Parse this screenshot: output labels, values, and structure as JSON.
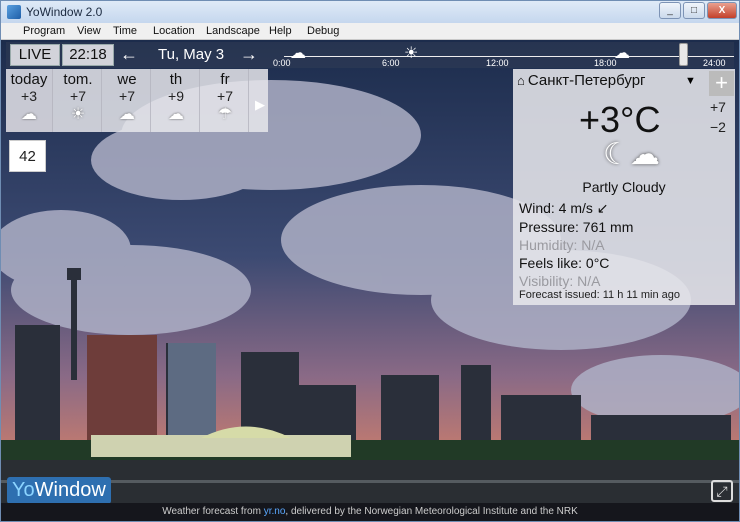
{
  "window": {
    "title": "YoWindow 2.0",
    "min": "_",
    "max": "□",
    "close": "X"
  },
  "menu": [
    "Program",
    "View",
    "Time",
    "Location",
    "Landscape",
    "Help",
    "Debug"
  ],
  "timebar": {
    "live": "LIVE",
    "time": "22:18",
    "prev": "←",
    "date": "Tu, May 3",
    "next": "→",
    "ticks": [
      "0:00",
      "6:00",
      "12:00",
      "18:00",
      "24:00"
    ]
  },
  "forecast": [
    {
      "day": "today",
      "temp": "+3",
      "icon": "cloud-icon"
    },
    {
      "day": "tom.",
      "temp": "+7",
      "icon": "sun-icon"
    },
    {
      "day": "we",
      "temp": "+7",
      "icon": "cloud-icon"
    },
    {
      "day": "th",
      "temp": "+9",
      "icon": "cloud-icon"
    },
    {
      "day": "fr",
      "temp": "+7",
      "icon": "rain-cloud-icon"
    }
  ],
  "forecast_more": "▶",
  "counter": "42",
  "panel": {
    "location": "Санкт-Петербург",
    "dropdown": "▼",
    "add": "+",
    "max": "+7",
    "min": "−2",
    "temp": "+3°C",
    "condition": "Partly Cloudy",
    "wind": "Wind:  4 m/s  ↙",
    "pressure": "Pressure:  761 mm",
    "humidity": "Humidity:  N/A",
    "feels": "Feels like:  0°C",
    "visibility": "Visibility:  N/A",
    "issued": "Forecast issued:  11 h 11 min ago"
  },
  "logo": {
    "yo": "Yo",
    "window": "Window"
  },
  "footer": {
    "prefix": "Weather forecast from ",
    "link": "yr.no",
    "suffix": ", delivered by the Norwegian Meteorological Institute and the NRK"
  },
  "fullscreen": "⤢"
}
